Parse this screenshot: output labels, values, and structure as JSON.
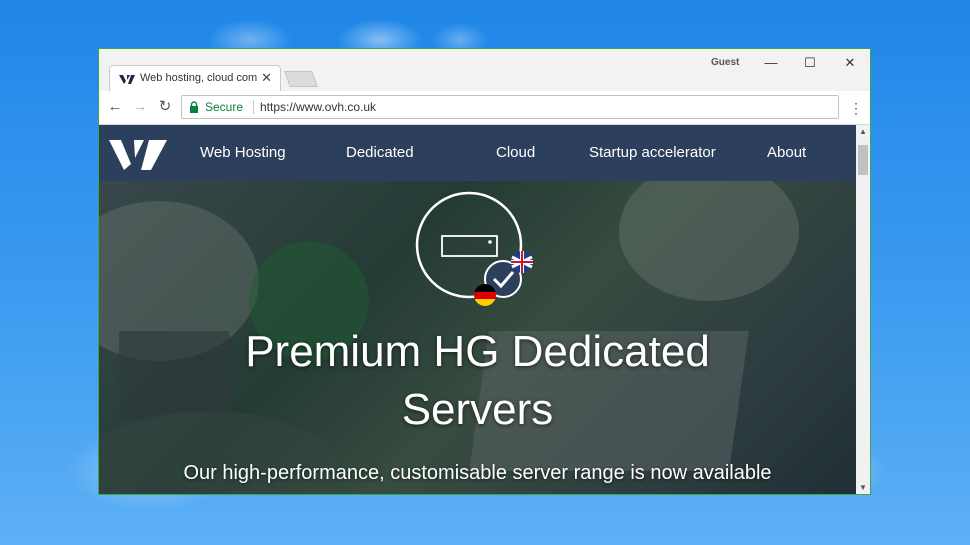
{
  "browser": {
    "tab_title": "Web hosting, cloud comp",
    "tab_close": "✕",
    "profile_label": "Guest",
    "window_controls": {
      "minimize": "—",
      "maximize": "☐",
      "close": "✕"
    },
    "nav": {
      "back": "←",
      "forward": "→",
      "reload": "↻"
    },
    "security_label": "Secure",
    "url": "https://www.ovh.co.uk",
    "menu": "⋮",
    "scroll_up": "▲",
    "scroll_down": "▼"
  },
  "site": {
    "nav_items": [
      "Web Hosting",
      "Dedicated",
      "Cloud",
      "Startup accelerator",
      "About"
    ],
    "hero": {
      "title_line1": "Premium HG Dedicated",
      "title_line2": "Servers",
      "subtitle": "Our high-performance, customisable server range is now available"
    }
  },
  "icons": {
    "logo": "ovh-logo-icon",
    "emblem": "server-check-icon",
    "flags": [
      "uk-flag-icon",
      "germany-flag-icon"
    ]
  },
  "colors": {
    "nav_bg": "#2c3f5c",
    "secure_green": "#0b8043",
    "window_border": "#3aa84a",
    "desktop_blue": "#1f86e8"
  }
}
